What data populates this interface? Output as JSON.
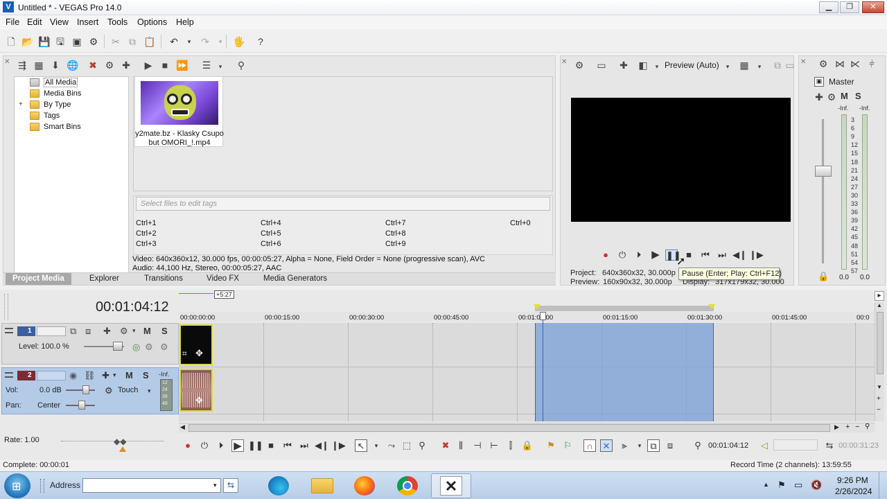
{
  "window": {
    "title": "Untitled * - VEGAS Pro 14.0",
    "logo_glyph": "V",
    "buttons": {
      "minimize": "▁",
      "maximize": "❐",
      "close": "✕"
    }
  },
  "menu": [
    "File",
    "Edit",
    "View",
    "Insert",
    "Tools",
    "Options",
    "Help"
  ],
  "project_media": {
    "tree": [
      {
        "label": "All Media",
        "selected": true
      },
      {
        "label": "Media Bins"
      },
      {
        "label": "By Type",
        "expander": "+"
      },
      {
        "label": "Tags"
      },
      {
        "label": "Smart Bins"
      }
    ],
    "media_item": {
      "line1": "y2mate.bz - Klasky Csupo",
      "line2": "but OMORI_!.mp4"
    },
    "tags_placeholder": "Select files to edit tags",
    "shortcuts": [
      "Ctrl+1",
      "Ctrl+2",
      "Ctrl+3",
      "Ctrl+4",
      "Ctrl+5",
      "Ctrl+6",
      "Ctrl+7",
      "Ctrl+8",
      "Ctrl+9",
      "Ctrl+0"
    ],
    "video_info": "Video: 640x360x12, 30.000 fps, 00:00:05:27, Alpha = None, Field Order = None (progressive scan), AVC",
    "audio_info": "Audio: 44,100 Hz, Stereo, 00:00:05:27, AAC"
  },
  "window_tabs": [
    "Project Media",
    "Explorer",
    "Transitions",
    "Video FX",
    "Media Generators"
  ],
  "preview": {
    "mode": "Preview (Auto)",
    "tooltip": "Pause (Enter; Play: Ctrl+F12)",
    "project_label": "Project:",
    "project_value": "640x360x32, 30.000p",
    "preview_label": "Preview:",
    "preview_value": "160x90x32, 30.000p",
    "display_label": "Display:",
    "display_value": "317x179x32, 30.000"
  },
  "master": {
    "title": "Master",
    "mute": "M",
    "solo": "S",
    "inf_left": "-Inf.",
    "inf_right": "-Inf.",
    "scale": [
      "3",
      "6",
      "9",
      "12",
      "15",
      "18",
      "21",
      "24",
      "27",
      "30",
      "33",
      "36",
      "39",
      "42",
      "45",
      "48",
      "51",
      "54",
      "57"
    ],
    "level_left": "0.0",
    "level_right": "0.0"
  },
  "timeline": {
    "time_display": "00:01:04:12",
    "loop_badge": "+5:27",
    "ruler": [
      "00:00:00:00",
      "00:00:15:00",
      "00:00:30:00",
      "00:00:45:00",
      "00:01:00:00",
      "00:01:15:00",
      "00:01:30:00",
      "00:01:45:00",
      "00:0"
    ],
    "video_track": {
      "number": "1",
      "level": "Level: 100.0 %",
      "mute": "M",
      "solo": "S"
    },
    "audio_track": {
      "number": "2",
      "vol_label": "Vol:",
      "vol_value": "0.0 dB",
      "pan_label": "Pan:",
      "pan_value": "Center",
      "touch": "Touch",
      "mute": "M",
      "solo": "S",
      "inf": "-Inf.",
      "meter": [
        "12",
        "24",
        "36",
        "48"
      ]
    },
    "rate": "Rate: 1.00",
    "cursor_time": "00:01:04:12",
    "end_time": "00:00:31:23"
  },
  "status": {
    "complete": "Complete: 00:00:01",
    "record_time": "Record Time (2 channels): 13:59:55"
  },
  "taskbar": {
    "address_label": "Address",
    "time": "9:26 PM",
    "date": "2/26/2024"
  }
}
